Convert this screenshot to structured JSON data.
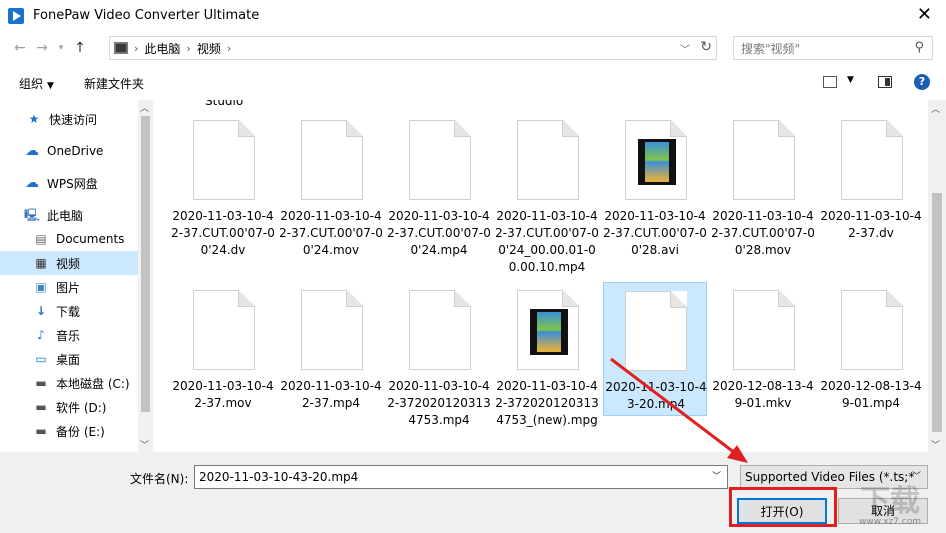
{
  "window": {
    "title": "FonePaw Video Converter Ultimate"
  },
  "address": {
    "crumbs": [
      "此电脑",
      "视频"
    ]
  },
  "search": {
    "placeholder": "搜索\"视频\""
  },
  "toolbar": {
    "organize": "组织",
    "new_folder": "新建文件夹"
  },
  "sidebar": {
    "items": [
      {
        "label": "快速访问",
        "icon": "star-icon"
      },
      {
        "label": "OneDrive",
        "icon": "cloud-icon"
      },
      {
        "label": "WPS网盘",
        "icon": "wps-cloud-icon"
      },
      {
        "label": "此电脑",
        "icon": "computer-icon"
      },
      {
        "label": "Documents",
        "icon": "document-icon"
      },
      {
        "label": "视频",
        "icon": "video-folder-icon"
      },
      {
        "label": "图片",
        "icon": "image-icon"
      },
      {
        "label": "下载",
        "icon": "download-icon"
      },
      {
        "label": "音乐",
        "icon": "music-icon"
      },
      {
        "label": "桌面",
        "icon": "desktop-icon"
      },
      {
        "label": "本地磁盘 (C:)",
        "icon": "drive-icon"
      },
      {
        "label": "软件 (D:)",
        "icon": "drive-icon"
      },
      {
        "label": "备份 (E:)",
        "icon": "drive-icon"
      }
    ]
  },
  "content": {
    "partial_label": "Studio",
    "files": [
      {
        "name": "2020-11-03-10-42-37.CUT.00'07-00'24.dv",
        "video": false
      },
      {
        "name": "2020-11-03-10-42-37.CUT.00'07-00'24.mov",
        "video": false
      },
      {
        "name": "2020-11-03-10-42-37.CUT.00'07-00'24.mp4",
        "video": false
      },
      {
        "name": "2020-11-03-10-42-37.CUT.00'07-00'24_00.00.01-00.00.10.mp4",
        "video": false
      },
      {
        "name": "2020-11-03-10-42-37.CUT.00'07-00'28.avi",
        "video": true
      },
      {
        "name": "2020-11-03-10-42-37.CUT.00'07-00'28.mov",
        "video": false
      },
      {
        "name": "2020-11-03-10-42-37.dv",
        "video": false
      },
      {
        "name": "2020-11-03-10-42-37.mov",
        "video": false
      },
      {
        "name": "2020-11-03-10-42-37.mp4",
        "video": false
      },
      {
        "name": "2020-11-03-10-42-3720201203134753.mp4",
        "video": false
      },
      {
        "name": "2020-11-03-10-42-3720201203134753_(new).mpg",
        "video": true
      },
      {
        "name": "2020-11-03-10-43-20.mp4",
        "video": false,
        "selected": true
      },
      {
        "name": "2020-12-08-13-49-01.mkv",
        "video": false
      },
      {
        "name": "2020-12-08-13-49-01.mp4",
        "video": false
      }
    ]
  },
  "bottom": {
    "filename_label": "文件名(N):",
    "filename_value": "2020-11-03-10-43-20.mp4",
    "filter_value": "Supported Video Files (*.ts;*",
    "open_label": "打开(O)",
    "cancel_label": "取消"
  },
  "watermark": {
    "site": "www.xz7.com"
  },
  "colors": {
    "selection": "#cce8ff",
    "annotation": "#e02020",
    "accent": "#0078d7"
  }
}
